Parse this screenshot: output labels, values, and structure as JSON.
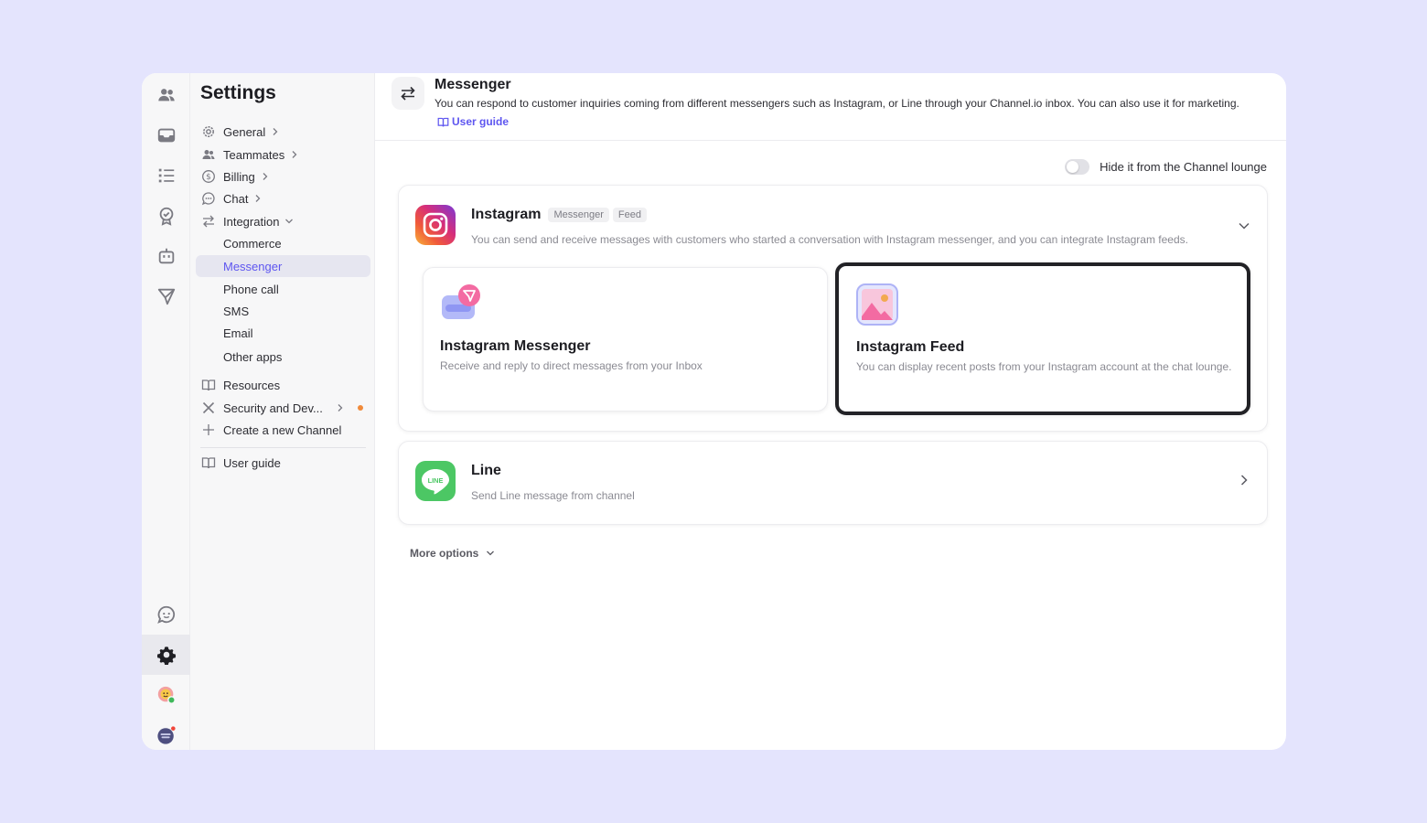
{
  "sidebar": {
    "title": "Settings",
    "items": [
      {
        "label": "General"
      },
      {
        "label": "Teammates"
      },
      {
        "label": "Billing"
      },
      {
        "label": "Chat"
      },
      {
        "label": "Integration"
      },
      {
        "label": "Commerce"
      },
      {
        "label": "Messenger"
      },
      {
        "label": "Phone call"
      },
      {
        "label": "SMS"
      },
      {
        "label": "Email"
      },
      {
        "label": "Other apps"
      },
      {
        "label": "Resources"
      },
      {
        "label": "Security and Dev..."
      },
      {
        "label": "Create a new Channel"
      },
      {
        "label": "User guide"
      }
    ]
  },
  "header": {
    "title": "Messenger",
    "description": "You can respond to customer inquiries coming from different messengers such as Instagram, or Line through your Channel.io inbox. You can also use it for marketing.",
    "guide_label": "User guide"
  },
  "toggle": {
    "label": "Hide it from the Channel lounge",
    "state": "off"
  },
  "instagram": {
    "title": "Instagram",
    "tags": [
      "Messenger",
      "Feed"
    ],
    "description": "You can send and receive messages with customers who started a conversation with Instagram messenger, and you can integrate Instagram feeds.",
    "options": [
      {
        "title": "Instagram Messenger",
        "description": "Receive and reply to direct messages from your Inbox"
      },
      {
        "title": "Instagram Feed",
        "description": "You can display recent posts from your Instagram account at the chat lounge."
      }
    ]
  },
  "line": {
    "title": "Line",
    "description": "Send Line message from channel",
    "logo_text": "LINE"
  },
  "more_options": "More options",
  "colors": {
    "background": "#e4e4fd",
    "accent": "#5e56f0",
    "line_green": "#4cc764",
    "notification": "#f0453a",
    "status_orange": "#f08a3a"
  }
}
